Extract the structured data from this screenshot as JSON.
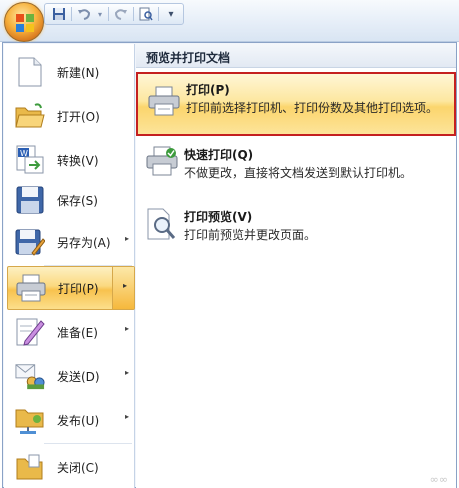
{
  "colors": {
    "accent": "#f8c24e",
    "highlight_border": "#c42020",
    "menu_border": "#8aa2c6"
  },
  "qat": {
    "icons": [
      "save-icon",
      "undo-icon",
      "redo-icon",
      "print-preview-icon",
      "customize-dropdown-icon"
    ],
    "customize_glyph": "▾"
  },
  "menu": {
    "items": [
      {
        "label": "新建(N)",
        "icon": "new-document-icon"
      },
      {
        "label": "打开(O)",
        "icon": "open-folder-icon"
      },
      {
        "label": "转换(V)",
        "icon": "convert-icon"
      },
      {
        "label": "保存(S)",
        "icon": "save-disk-icon"
      },
      {
        "label": "另存为(A)",
        "icon": "save-as-icon",
        "arrow": "▸"
      },
      {
        "label": "打印(P)",
        "icon": "printer-icon",
        "arrow": "▸",
        "active": true
      },
      {
        "label": "准备(E)",
        "icon": "prepare-icon",
        "arrow": "▸"
      },
      {
        "label": "发送(D)",
        "icon": "send-icon",
        "arrow": "▸"
      },
      {
        "label": "发布(U)",
        "icon": "publish-icon",
        "arrow": "▸"
      },
      {
        "label": "关闭(C)",
        "icon": "close-folder-icon"
      }
    ]
  },
  "panel": {
    "header": "预览并打印文档",
    "items": [
      {
        "title": "打印(P)",
        "desc": "打印前选择打印机、打印份数及其他打印选项。",
        "icon": "printer-icon",
        "selected": true
      },
      {
        "title": "快速打印(Q)",
        "desc": "不做更改，直接将文档发送到默认打印机。",
        "icon": "quick-print-icon"
      },
      {
        "title": "打印预览(V)",
        "desc": "打印前预览并更改页面。",
        "icon": "print-preview-icon"
      }
    ]
  },
  "watermark": "∞∞"
}
